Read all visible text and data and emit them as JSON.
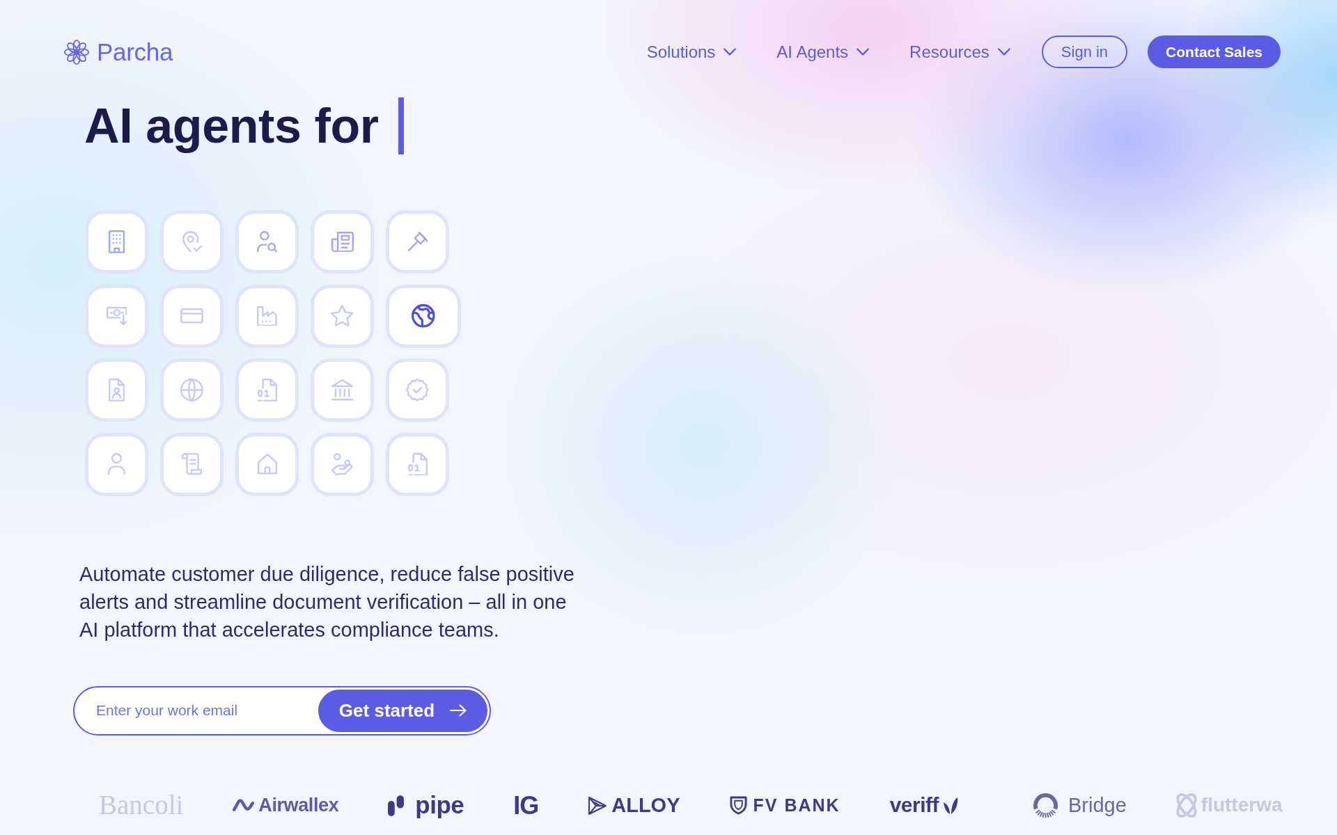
{
  "header": {
    "logo": {
      "text": "Parcha"
    },
    "nav": [
      {
        "label": "Solutions",
        "has_menu": true
      },
      {
        "label": "AI Agents",
        "has_menu": true
      },
      {
        "label": "Resources",
        "has_menu": true
      }
    ],
    "buttons": [
      {
        "label": "Sign in",
        "kind": "outline"
      },
      {
        "label": "Contact Sales",
        "kind": "filled"
      }
    ]
  },
  "hero": {
    "headline": "AI agents for",
    "typing_cursor": true,
    "icon_grid": {
      "rows": [
        {
          "tiles": [
            {
              "kind": "building",
              "selected": false,
              "dimmed": false
            },
            {
              "kind": "pin-check",
              "selected": false,
              "dimmed": true
            },
            {
              "kind": "user-search",
              "selected": false,
              "dimmed": false
            },
            {
              "kind": "newspaper",
              "selected": false,
              "dimmed": false
            },
            {
              "kind": "gavel",
              "selected": false,
              "dimmed": false
            }
          ]
        },
        {
          "tiles": [
            {
              "kind": "banknote",
              "selected": false,
              "dimmed": true
            },
            {
              "kind": "card",
              "selected": false,
              "dimmed": true
            },
            {
              "kind": "factory",
              "selected": false,
              "dimmed": true
            },
            {
              "kind": "star",
              "selected": false,
              "dimmed": true
            },
            {
              "kind": "earth",
              "selected": true,
              "dimmed": false
            }
          ]
        },
        {
          "tiles": [
            {
              "kind": "file-user",
              "selected": false,
              "dimmed": true
            },
            {
              "kind": "globe",
              "selected": false,
              "dimmed": true
            },
            {
              "kind": "file-binary",
              "selected": false,
              "dimmed": true
            },
            {
              "kind": "bank",
              "selected": false,
              "dimmed": true
            },
            {
              "kind": "badge",
              "selected": false,
              "dimmed": true
            }
          ]
        },
        {
          "tiles": [
            {
              "kind": "user",
              "selected": false,
              "dimmed": true
            },
            {
              "kind": "scroll",
              "selected": false,
              "dimmed": true
            },
            {
              "kind": "house",
              "selected": false,
              "dimmed": true
            },
            {
              "kind": "hand",
              "selected": false,
              "dimmed": true
            },
            {
              "kind": "file-binary",
              "selected": false,
              "dimmed": true
            }
          ]
        }
      ]
    },
    "description": "Automate customer due diligence, reduce false positive alerts and streamline document verification – all in one AI platform that accelerates compliance teams.",
    "email_form": {
      "placeholder": "Enter your work email",
      "button": "Get started"
    }
  },
  "logos": [
    {
      "kind": "serif",
      "text": "Bancoli",
      "faded": true
    },
    {
      "kind": "wave",
      "text": "Airwallex",
      "faded": false
    },
    {
      "kind": "bars",
      "text": "pipe",
      "faded": false
    },
    {
      "kind": "plain",
      "text": "IG",
      "faded": false
    },
    {
      "kind": "prism",
      "text": "ALLOY",
      "faded": false
    },
    {
      "kind": "shield",
      "text": "FV BANK",
      "faded": false
    },
    {
      "kind": "leaf",
      "text": "veriff",
      "faded": false
    },
    {
      "kind": "ring",
      "text": "Bridge",
      "faded": false
    },
    {
      "kind": "knot",
      "text": "flutterwa",
      "faded": true
    }
  ]
}
